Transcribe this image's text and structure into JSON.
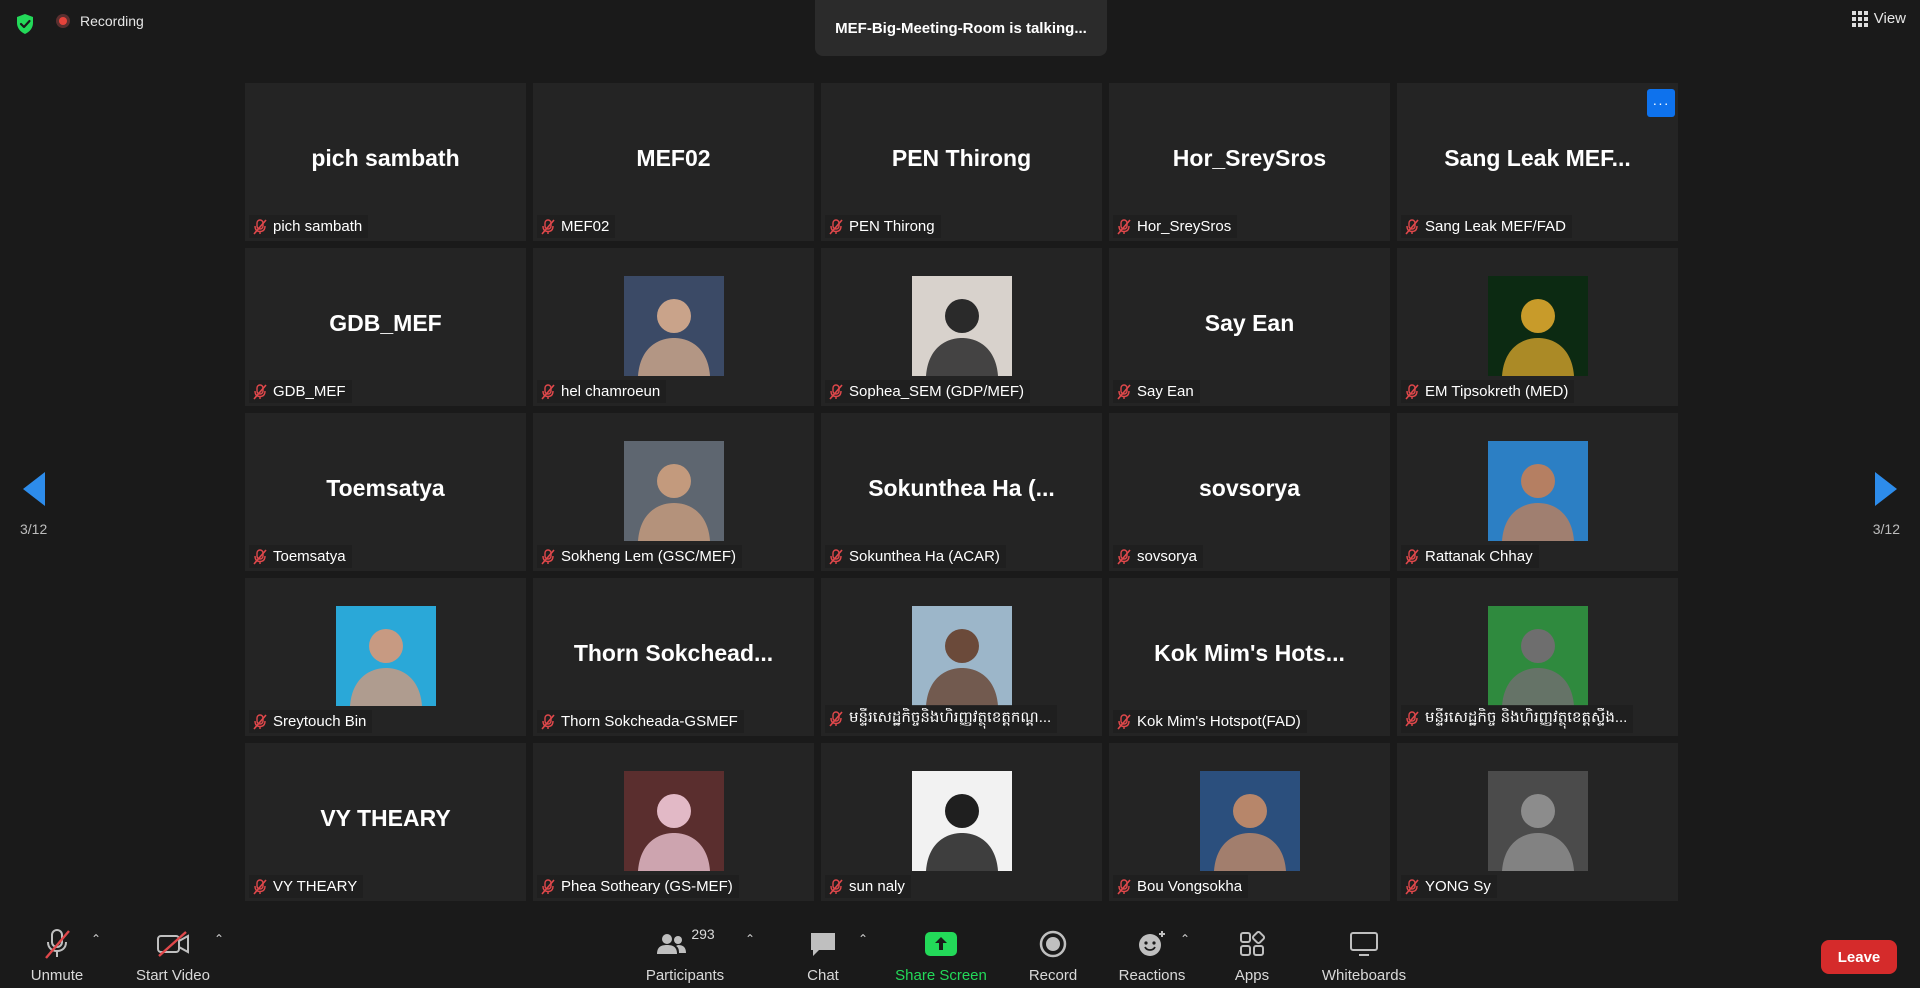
{
  "top_bar": {
    "recording_label": "Recording",
    "talking_text": "MEF-Big-Meeting-Room is talking...",
    "view_label": "View"
  },
  "gallery": {
    "page_indicator": "3/12",
    "tiles": [
      {
        "display": "pich sambath",
        "label": "pich sambath",
        "photo": false
      },
      {
        "display": "MEF02",
        "label": "MEF02",
        "photo": false
      },
      {
        "display": "PEN Thirong",
        "label": "PEN Thirong",
        "photo": false
      },
      {
        "display": "Hor_SreySros",
        "label": "Hor_SreySros",
        "photo": false
      },
      {
        "display": "Sang Leak  MEF...",
        "label": "Sang Leak  MEF/FAD",
        "photo": false
      },
      {
        "display": "GDB_MEF",
        "label": "GDB_MEF",
        "photo": false
      },
      {
        "display": "",
        "label": "hel chamroeun",
        "photo": true
      },
      {
        "display": "",
        "label": "Sophea_SEM (GDP/MEF)",
        "photo": true
      },
      {
        "display": "Say Ean",
        "label": "Say Ean",
        "photo": false
      },
      {
        "display": "",
        "label": "EM Tipsokreth (MED)",
        "photo": true
      },
      {
        "display": "Toemsatya",
        "label": "Toemsatya",
        "photo": false
      },
      {
        "display": "",
        "label": "Sokheng Lem (GSC/MEF)",
        "photo": true
      },
      {
        "display": "Sokunthea Ha (...",
        "label": "Sokunthea Ha (ACAR)",
        "photo": false
      },
      {
        "display": "sovsorya",
        "label": "sovsorya",
        "photo": false
      },
      {
        "display": "",
        "label": "Rattanak Chhay",
        "photo": true
      },
      {
        "display": "",
        "label": "Sreytouch Bin",
        "photo": true
      },
      {
        "display": "Thorn Sokchead...",
        "label": "Thorn Sokcheada-GSMEF",
        "photo": false
      },
      {
        "display": "",
        "label": "មន្ទីរសេដ្ឋកិច្ចនិងហិរញ្ញវត្ថុខេត្តកណ្ដ...",
        "photo": true
      },
      {
        "display": "Kok Mim's Hots...",
        "label": "Kok Mim's Hotspot(FAD)",
        "photo": false
      },
      {
        "display": "",
        "label": "មន្ទីរសេដ្ឋកិច្ច និងហិរញ្ញវត្ថុខេត្តស្ទឹង...",
        "photo": true
      },
      {
        "display": "VY THEARY",
        "label": "VY THEARY",
        "photo": false
      },
      {
        "display": "",
        "label": "Phea Sotheary (GS-MEF)",
        "photo": true
      },
      {
        "display": "",
        "label": "sun naly",
        "photo": true
      },
      {
        "display": "",
        "label": "Bou Vongsokha",
        "photo": true
      },
      {
        "display": "",
        "label": "YONG Sy",
        "photo": true
      }
    ]
  },
  "toolbar": {
    "unmute": "Unmute",
    "start_video": "Start Video",
    "participants_count": "293",
    "participants": "Participants",
    "chat": "Chat",
    "share_screen": "Share Screen",
    "record": "Record",
    "reactions": "Reactions",
    "apps": "Apps",
    "whiteboards": "Whiteboards",
    "leave": "Leave"
  },
  "colors": {
    "accent_blue": "#0e72ed",
    "share_green": "#23d959",
    "leave_red": "#d52b2b",
    "muted_red": "#e0484b",
    "nav_arrow": "#2d8ceb"
  }
}
